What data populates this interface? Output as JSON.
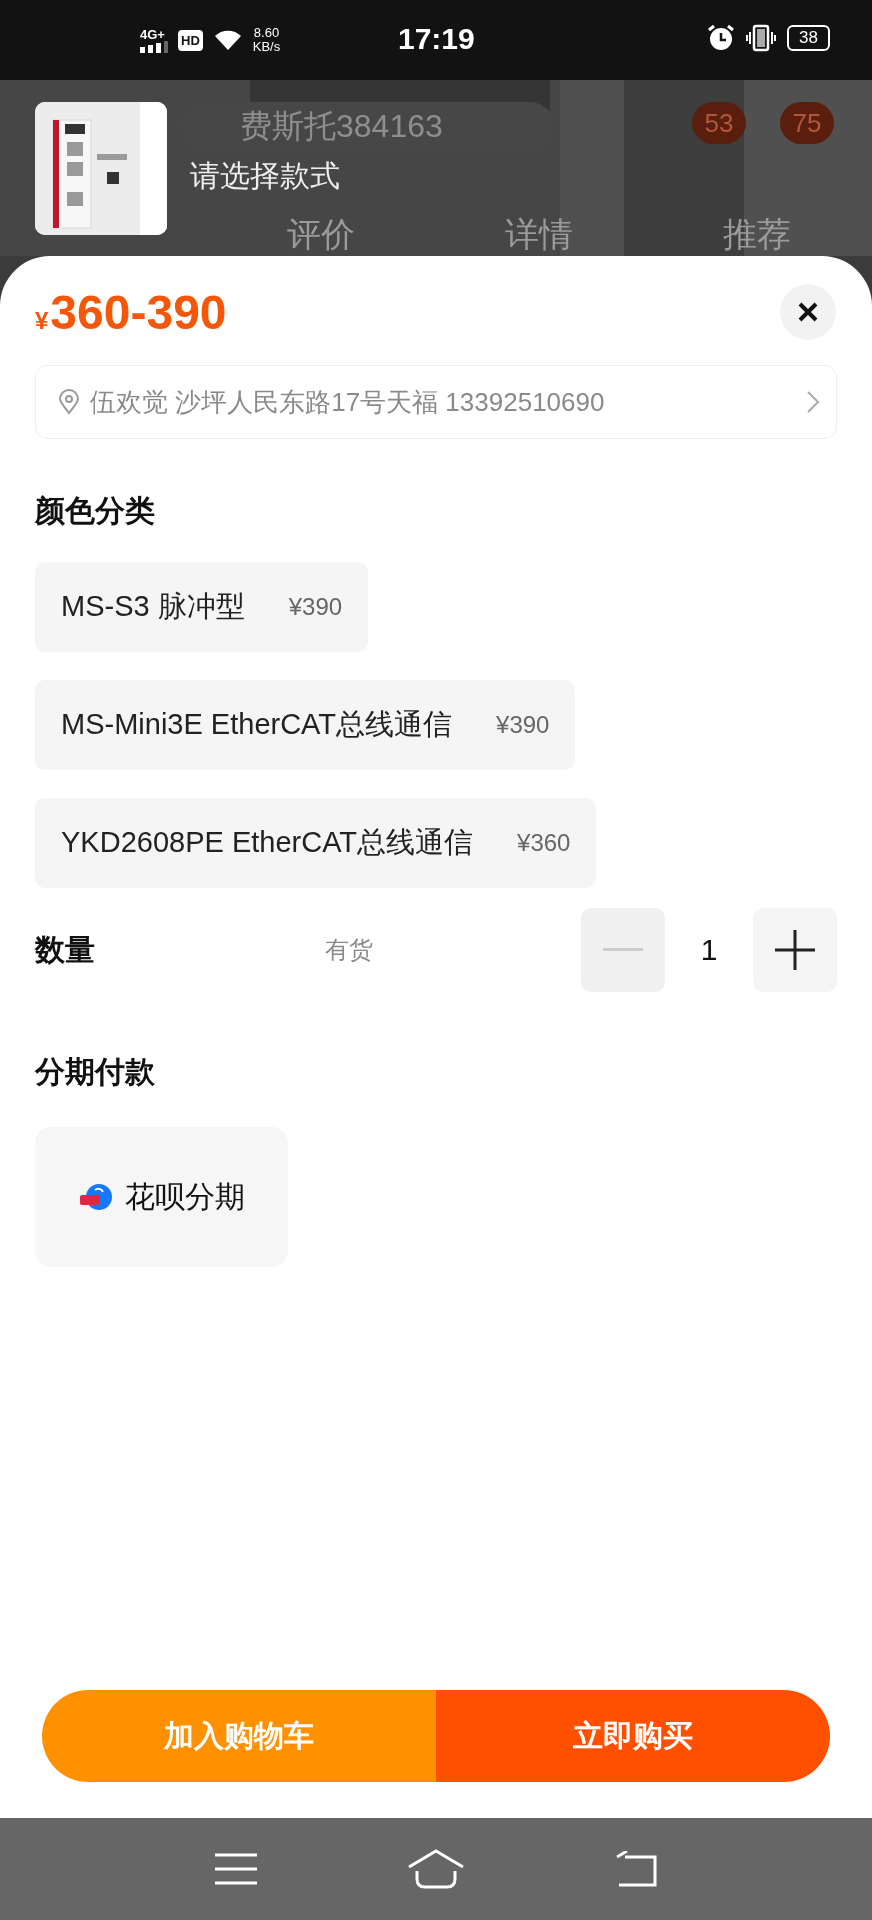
{
  "status_bar": {
    "network": "4G+",
    "hd": "HD",
    "speed": "8.60",
    "speed_unit": "KB/s",
    "time": "17:19",
    "battery": "38"
  },
  "background_page": {
    "search_text": "费斯托384163",
    "badges": [
      "53",
      "75"
    ],
    "tabs": [
      {
        "label": "评价",
        "selected": false
      },
      {
        "label": "详情",
        "selected": false
      },
      {
        "label": "推荐",
        "selected": false
      }
    ]
  },
  "sheet_header": {
    "title": "请选择款式"
  },
  "price": {
    "currency": "¥",
    "range": "360-390"
  },
  "address": "伍欢觉 沙坪人民东路17号天福 13392510690",
  "style_section": {
    "title": "颜色分类",
    "options": [
      {
        "name": "MS-S3 脉冲型",
        "price": "¥390",
        "selected": false
      },
      {
        "name": "MS-Mini3E EtherCAT总线通信",
        "price": "¥390",
        "selected": false
      },
      {
        "name": "YKD2608PE EtherCAT总线通信",
        "price": "¥360",
        "selected": false
      }
    ]
  },
  "quantity": {
    "label": "数量",
    "stock": "有货",
    "value": "1",
    "decrement_disabled": true,
    "increment_disabled": false
  },
  "installments": {
    "title": "分期付款",
    "options": [
      {
        "label": "花呗分期",
        "selected": false
      }
    ]
  },
  "actions": {
    "add_to_cart": "加入购物车",
    "buy_now": "立即购买"
  }
}
